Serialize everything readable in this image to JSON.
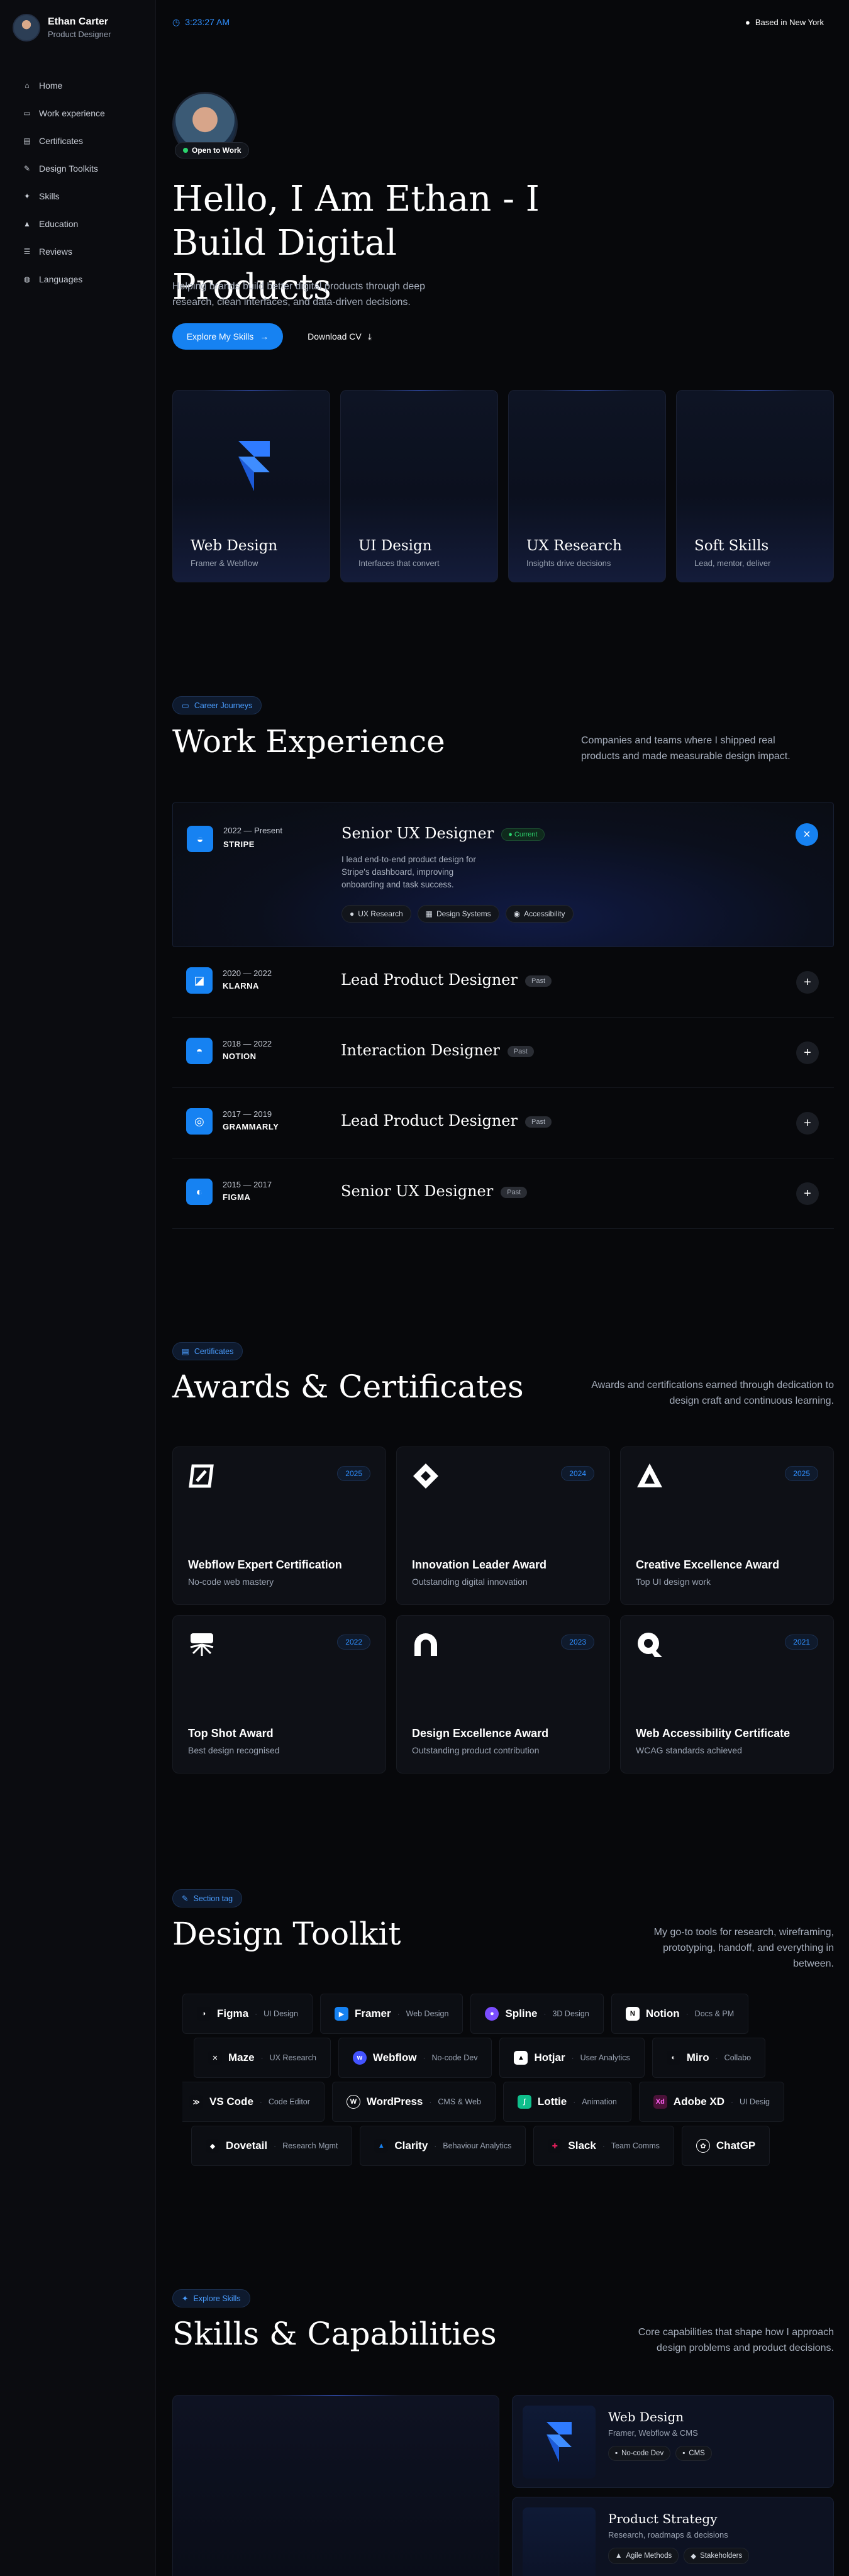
{
  "sidebar": {
    "name": "Ethan Carter",
    "role": "Product Designer",
    "items": [
      {
        "label": "Home",
        "icon": "home-icon"
      },
      {
        "label": "Work experience",
        "icon": "briefcase-icon"
      },
      {
        "label": "Certificates",
        "icon": "certificate-icon"
      },
      {
        "label": "Design Toolkits",
        "icon": "pen-icon"
      },
      {
        "label": "Skills",
        "icon": "skills-icon"
      },
      {
        "label": "Education",
        "icon": "education-icon"
      },
      {
        "label": "Reviews",
        "icon": "reviews-icon"
      },
      {
        "label": "Languages",
        "icon": "globe-icon"
      }
    ]
  },
  "topbar": {
    "time": "3:23:27 AM",
    "location": "Based in New York"
  },
  "hero": {
    "status": "Open to Work",
    "title": "Hello, I Am Ethan - I Build Digital Products",
    "subtitle": "Helping brands build better digital products through deep research, clean interfaces, and data-driven decisions.",
    "primary_cta": "Explore My Skills",
    "secondary_cta": "Download CV"
  },
  "services": [
    {
      "title": "Web Design",
      "desc": "Framer & Webflow"
    },
    {
      "title": "UI Design",
      "desc": "Interfaces that convert"
    },
    {
      "title": "UX Research",
      "desc": "Insights drive decisions"
    },
    {
      "title": "Soft Skills",
      "desc": "Lead, mentor, deliver"
    }
  ],
  "experience": {
    "tag": "Career Journeys",
    "title": "Work Experience",
    "desc": "Companies and teams where I shipped real products and made measurable design impact.",
    "active": {
      "years": "2022 — Present",
      "company": "STRIPE",
      "role": "Senior UX Designer",
      "badge": "Current",
      "body": "I lead end-to-end product design for Stripe's dashboard, improving onboarding and task success.",
      "chips": [
        "UX Research",
        "Design Systems",
        "Accessibility"
      ]
    },
    "rows": [
      {
        "years": "2020 — 2022",
        "company": "KLARNA",
        "role": "Lead Product Designer",
        "badge": "Past"
      },
      {
        "years": "2018 — 2022",
        "company": "NOTION",
        "role": "Interaction Designer",
        "badge": "Past"
      },
      {
        "years": "2017 — 2019",
        "company": "GRAMMARLY",
        "role": "Lead Product Designer",
        "badge": "Past"
      },
      {
        "years": "2015 — 2017",
        "company": "FIGMA",
        "role": "Senior UX Designer",
        "badge": "Past"
      }
    ]
  },
  "awards": {
    "tag": "Certificates",
    "title": "Awards & Certificates",
    "desc": "Awards and certifications earned through dedication to design craft and continuous learning.",
    "items": [
      {
        "title": "Webflow Expert Certification",
        "sub": "No-code web mastery",
        "year": "2025"
      },
      {
        "title": "Innovation Leader Award",
        "sub": "Outstanding digital innovation",
        "year": "2024"
      },
      {
        "title": "Creative Excellence Award",
        "sub": "Top UI design work",
        "year": "2025"
      },
      {
        "title": "Top Shot Award",
        "sub": "Best design recognised",
        "year": "2022"
      },
      {
        "title": "Design Excellence Award",
        "sub": "Outstanding product contribution",
        "year": "2023"
      },
      {
        "title": "Web Accessibility Certificate",
        "sub": "WCAG standards achieved",
        "year": "2021"
      }
    ]
  },
  "toolkit": {
    "tag": "Section tag",
    "title": "Design Toolkit",
    "desc": "My go-to tools for research, wireframing, prototyping, handoff, and everything in between.",
    "rows": [
      [
        {
          "name": "Figma",
          "cat": "UI Design",
          "color": "#0b0d12"
        },
        {
          "name": "Framer",
          "cat": "Web Design",
          "color": "#1682f2"
        },
        {
          "name": "Spline",
          "cat": "3D Design",
          "color": "#7b4dff"
        },
        {
          "name": "Notion",
          "cat": "Docs & PM",
          "color": "#0b0d12"
        }
      ],
      [
        {
          "name": "Maze",
          "cat": "UX Research",
          "color": "#0b0d12"
        },
        {
          "name": "Webflow",
          "cat": "No-code Dev",
          "color": "#4353ff"
        },
        {
          "name": "Hotjar",
          "cat": "User Analytics",
          "color": "#0b0d12"
        },
        {
          "name": "Miro",
          "cat": "Collabo",
          "color": "#0b0d12"
        }
      ],
      [
        {
          "name": "VS Code",
          "cat": "Code Editor",
          "color": "#0b0d12"
        },
        {
          "name": "WordPress",
          "cat": "CMS & Web",
          "color": "#0b0d12"
        },
        {
          "name": "Lottie",
          "cat": "Animation",
          "color": "#0fbf8c"
        },
        {
          "name": "Adobe XD",
          "cat": "UI Desig",
          "color": "#4a1238"
        }
      ],
      [
        {
          "name": "Dovetail",
          "cat": "Research Mgmt",
          "color": "#0b0d12"
        },
        {
          "name": "Clarity",
          "cat": "Behaviour Analytics",
          "color": "#1682f2"
        },
        {
          "name": "Slack",
          "cat": "Team Comms",
          "color": "#0b0d12"
        },
        {
          "name": "ChatGP",
          "cat": "",
          "color": "#0b0d12"
        }
      ]
    ]
  },
  "skills": {
    "tag": "Explore Skills",
    "title": "Skills & Capabilities",
    "desc": "Core capabilities that shape how I approach design problems and product decisions.",
    "cards": [
      {
        "title": "Web Design",
        "sub": "Framer, Webflow & CMS",
        "chips": [
          "No-code Dev",
          "CMS"
        ]
      },
      {
        "title": "Product Strategy",
        "sub": "Research, roadmaps & decisions",
        "chips": [
          "Agile Methods",
          "Stakeholders"
        ]
      }
    ]
  }
}
